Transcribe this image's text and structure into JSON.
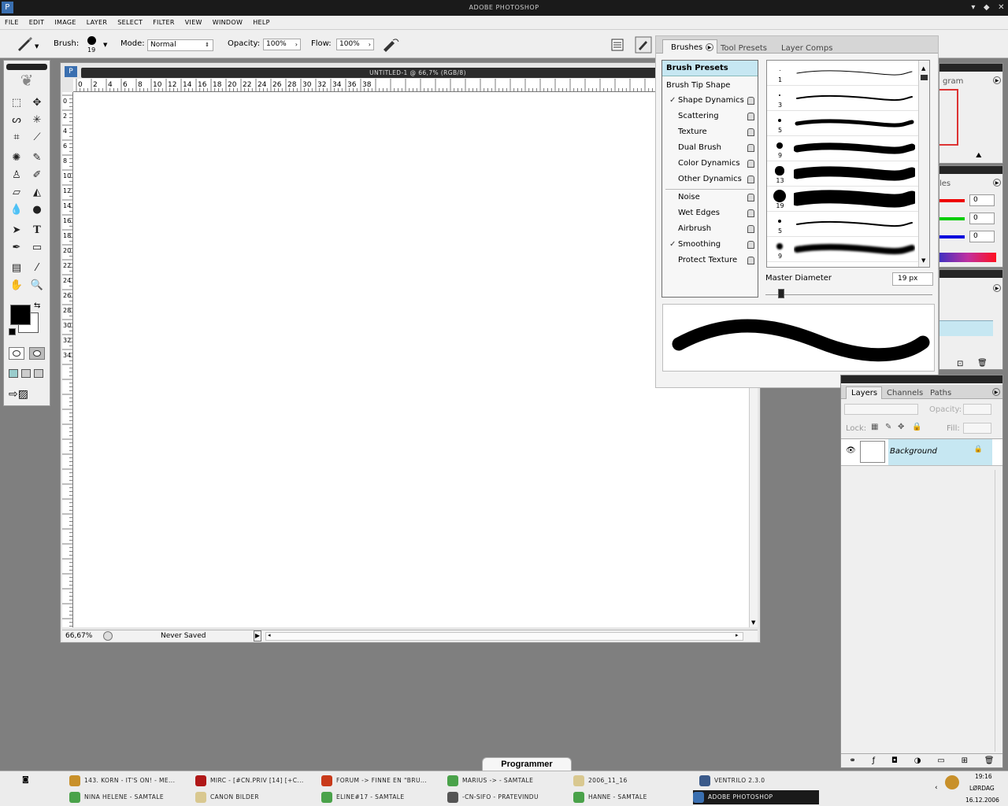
{
  "app": {
    "title": "ADOBE PHOTOSHOP"
  },
  "menu": [
    "FILE",
    "EDIT",
    "IMAGE",
    "LAYER",
    "SELECT",
    "FILTER",
    "VIEW",
    "WINDOW",
    "HELP"
  ],
  "options": {
    "brush_label": "Brush:",
    "brush_size": "19",
    "mode_label": "Mode:",
    "mode_value": "Normal",
    "opacity_label": "Opacity:",
    "opacity_value": "100%",
    "flow_label": "Flow:",
    "flow_value": "100%"
  },
  "document": {
    "title": "UNTITLED-1 @ 66,7% (RGB/8)",
    "zoom": "66,67%",
    "status": "Never Saved",
    "ruler_h": [
      "0",
      "2",
      "4",
      "6",
      "8",
      "10",
      "12",
      "14",
      "16",
      "18",
      "20",
      "22",
      "24",
      "26",
      "28",
      "30",
      "32",
      "34",
      "36",
      "38"
    ],
    "ruler_v": [
      "0",
      "2",
      "4",
      "6",
      "8",
      "10",
      "12",
      "14",
      "16",
      "18",
      "20",
      "22",
      "24",
      "26",
      "28",
      "30",
      "32",
      "34"
    ]
  },
  "brushes_panel": {
    "tabs": [
      "Brushes",
      "Tool Presets",
      "Layer Comps"
    ],
    "header": "Brush Presets",
    "section": "Brush Tip Shape",
    "options": [
      {
        "label": "Shape Dynamics",
        "checked": true
      },
      {
        "label": "Scattering",
        "checked": false
      },
      {
        "label": "Texture",
        "checked": false
      },
      {
        "label": "Dual Brush",
        "checked": false
      },
      {
        "label": "Color Dynamics",
        "checked": false
      },
      {
        "label": "Other Dynamics",
        "checked": false
      },
      {
        "label": "Noise",
        "checked": false
      },
      {
        "label": "Wet Edges",
        "checked": false
      },
      {
        "label": "Airbrush",
        "checked": false
      },
      {
        "label": "Smoothing",
        "checked": true
      },
      {
        "label": "Protect Texture",
        "checked": false
      }
    ],
    "presets": [
      "1",
      "3",
      "5",
      "9",
      "13",
      "19",
      "5",
      "9"
    ],
    "master_label": "Master Diameter",
    "master_value": "19 px"
  },
  "side_panels": {
    "history_label": "gram",
    "styles_label": "les",
    "color_values": [
      "0",
      "0",
      "0"
    ]
  },
  "layers_panel": {
    "tabs": [
      "Layers",
      "Channels",
      "Paths"
    ],
    "opacity_label": "Opacity:",
    "lock_label": "Lock:",
    "fill_label": "Fill:",
    "layer_name": "Background"
  },
  "taskbar": {
    "programs_label": "Programmer",
    "items": [
      {
        "label": "143. KORN - IT'S ON! - ME...",
        "color": "#c8902a"
      },
      {
        "label": "MIRC - [#CN.PRIV [14] [+C...",
        "color": "#b01818"
      },
      {
        "label": "FORUM -> FINNE EN \"BRU...",
        "color": "#c83a1a"
      },
      {
        "label": "MARIUS -> - SAMTALE",
        "color": "#4aa24a"
      },
      {
        "label": "2006_11_16",
        "color": "#d9c890"
      },
      {
        "label": "VENTRILO 2.3.0",
        "color": "#3a5a8a"
      },
      {
        "label": "NINA HELENE - SAMTALE",
        "color": "#4aa24a"
      },
      {
        "label": "CANON BILDER",
        "color": "#d9c890"
      },
      {
        "label": "ELINE#17 - SAMTALE",
        "color": "#4aa24a"
      },
      {
        "label": "-CN-SIFO - PRATEVINDU",
        "color": "#555555"
      },
      {
        "label": "HANNE - SAMTALE",
        "color": "#4aa24a"
      },
      {
        "label": "ADOBE PHOTOSHOP",
        "color": "#3a6fb0"
      }
    ],
    "time": "19:16",
    "day": "LØRDAG",
    "date": "16.12.2006"
  }
}
